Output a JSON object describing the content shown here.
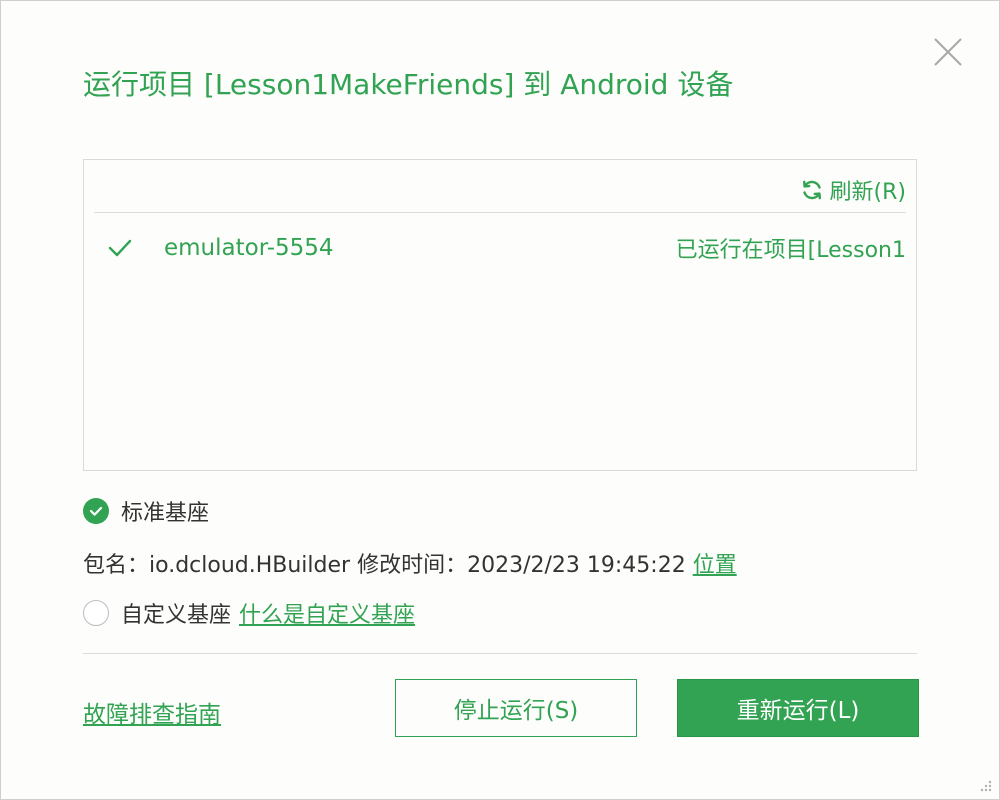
{
  "dialog": {
    "title": "运行项目 [Lesson1MakeFriends] 到 Android 设备",
    "close_icon": "close-icon"
  },
  "device_panel": {
    "refresh_label": "刷新(R)",
    "refresh_icon": "refresh-icon",
    "devices": [
      {
        "name": "emulator-5554",
        "status": "已运行在项目[Lesson1",
        "selected": true,
        "icon": "checkmark-icon"
      }
    ]
  },
  "base": {
    "standard": {
      "label": "标准基座",
      "selected": true
    },
    "package_info": {
      "package_prefix": "包名：",
      "package_name": "io.dcloud.HBuilder",
      "modified_prefix": "修改时间：",
      "modified_time": "2023/2/23 19:45:22",
      "location_link": "位置"
    },
    "custom": {
      "label": "自定义基座",
      "selected": false,
      "help_link": "什么是自定义基座"
    }
  },
  "footer": {
    "troubleshoot_link": "故障排查指南",
    "stop_button": "停止运行(S)",
    "restart_button": "重新运行(L)"
  },
  "colors": {
    "accent": "#31a352",
    "text": "#333333",
    "border": "#d9d9d9",
    "background": "#fdfdfb"
  }
}
